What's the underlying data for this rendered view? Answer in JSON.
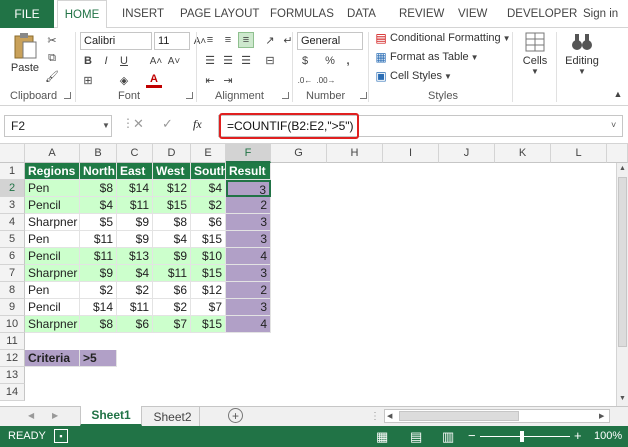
{
  "tabs": {
    "file": "FILE",
    "items": [
      "HOME",
      "INSERT",
      "PAGE LAYOUT",
      "FORMULAS",
      "DATA",
      "REVIEW",
      "VIEW",
      "DEVELOPER"
    ],
    "signin": "Sign in"
  },
  "ribbon": {
    "clipboard": {
      "label": "Clipboard",
      "paste": "Paste"
    },
    "font": {
      "label": "Font",
      "name": "Calibri",
      "size": "11"
    },
    "alignment": {
      "label": "Alignment"
    },
    "number": {
      "label": "Number",
      "format": "General"
    },
    "styles": {
      "label": "Styles",
      "conditional": "Conditional Formatting",
      "format_table": "Format as Table",
      "cell_styles": "Cell Styles"
    },
    "cells": {
      "label": "Cells"
    },
    "editing": {
      "label": "Editing"
    }
  },
  "formula_bar": {
    "name_box": "F2",
    "fx": "fx",
    "formula": "=COUNTIF(B2:E2,\">5\")"
  },
  "columns": [
    "A",
    "B",
    "C",
    "D",
    "E",
    "F",
    "G",
    "H",
    "I",
    "J",
    "K",
    "L"
  ],
  "rows": [
    "1",
    "2",
    "3",
    "4",
    "5",
    "6",
    "7",
    "8",
    "9",
    "10",
    "11",
    "12",
    "13",
    "14"
  ],
  "table": {
    "headers": [
      "Regions",
      "North",
      "East",
      "West",
      "South",
      "Result"
    ],
    "data": [
      [
        "Pen",
        "$8",
        "$14",
        "$12",
        "$4",
        "3"
      ],
      [
        "Pencil",
        "$4",
        "$11",
        "$15",
        "$2",
        "2"
      ],
      [
        "Sharpner",
        "$5",
        "$9",
        "$8",
        "$6",
        "3"
      ],
      [
        "Pen",
        "$11",
        "$9",
        "$4",
        "$15",
        "3"
      ],
      [
        "Pencil",
        "$11",
        "$13",
        "$9",
        "$10",
        "4"
      ],
      [
        "Sharpner",
        "$9",
        "$4",
        "$11",
        "$15",
        "3"
      ],
      [
        "Pen",
        "$2",
        "$2",
        "$6",
        "$12",
        "2"
      ],
      [
        "Pencil",
        "$14",
        "$11",
        "$2",
        "$7",
        "3"
      ],
      [
        "Sharpner",
        "$8",
        "$6",
        "$7",
        "$15",
        "4"
      ]
    ]
  },
  "criteria": {
    "label": "Criteria",
    "value": ">5"
  },
  "sheets": [
    "Sheet1",
    "Sheet2"
  ],
  "status": {
    "ready": "READY",
    "zoom": "100%"
  },
  "colors": {
    "excel_green": "#217346",
    "header_green": "#1f7a45",
    "row_green": "#ccffcc",
    "result_purple": "#b1a0c7",
    "highlight_red": "#e02020"
  }
}
